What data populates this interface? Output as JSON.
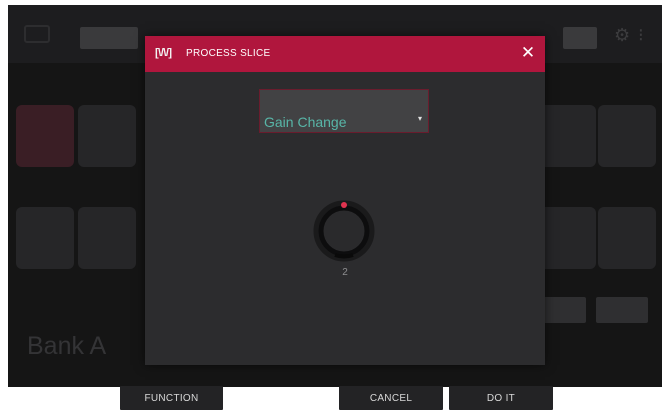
{
  "background": {
    "bank_label": "Bank A",
    "corner_glyph": "n"
  },
  "dialog": {
    "logo_text": "[\\/\\/]",
    "title": "PROCESS SLICE",
    "close_glyph": "✕",
    "dropdown": {
      "selected": "Gain Change",
      "arrow_glyph": "▾"
    },
    "knob": {
      "value": "2",
      "accent_color": "#e0334f"
    }
  },
  "bottom_bar": {
    "function_label": "FUNCTION",
    "cancel_label": "CANCEL",
    "doit_label": "DO IT"
  },
  "colors": {
    "header": "#b0163d",
    "dropdown_text": "#58b6a8",
    "panel": "#2c2c2e"
  }
}
